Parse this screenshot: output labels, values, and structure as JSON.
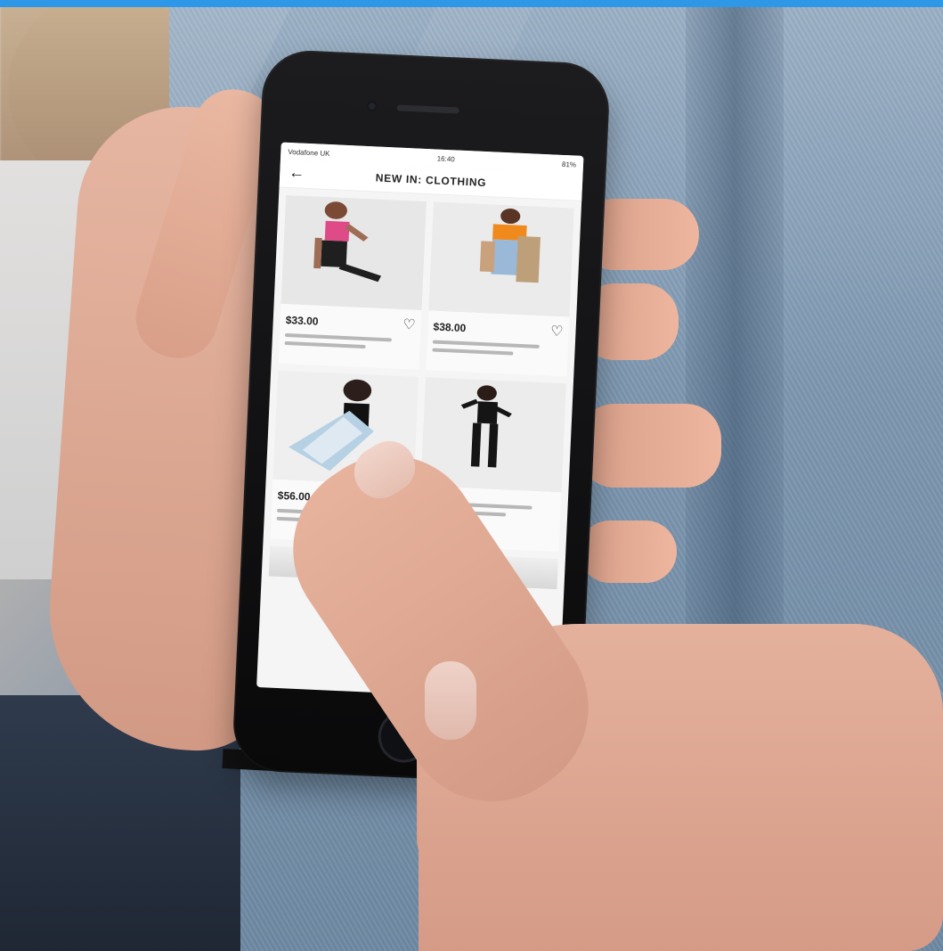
{
  "status": {
    "carrier": "Vodafone UK",
    "time": "16:40",
    "battery": "81%"
  },
  "screen": {
    "title": "NEW IN: CLOTHING"
  },
  "products": [
    {
      "price": "$33.00",
      "heart_icon": "heart-icon"
    },
    {
      "price": "$38.00",
      "heart_icon": "heart-icon"
    },
    {
      "price": "$56.00",
      "heart_icon": "heart-icon"
    }
  ],
  "colors": {
    "top_bar": "#2f97e8"
  }
}
